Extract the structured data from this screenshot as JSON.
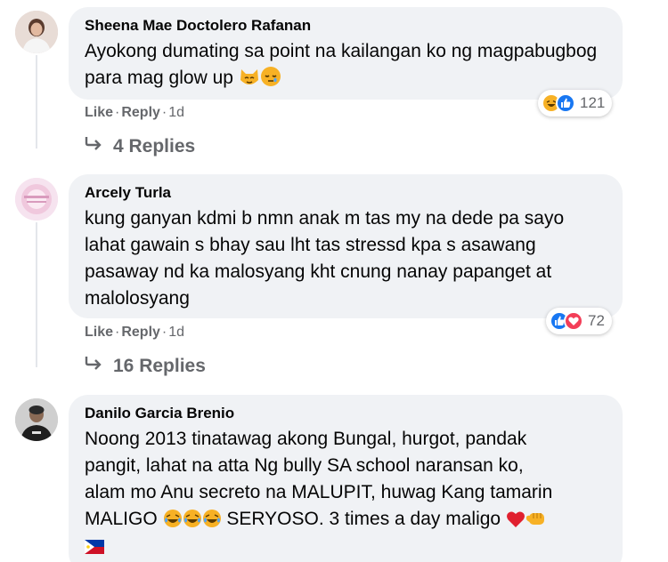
{
  "comments": [
    {
      "author": "Sheena Mae Doctolero Rafanan",
      "text": "Ayokong dumating sa point na kailangan ko ng magpabugbog para mag glow up",
      "like": "Like",
      "reply": "Reply",
      "time": "1d",
      "reaction_icons": [
        "haha-icon",
        "like-icon"
      ],
      "reaction_count": "121",
      "replies_label": "4 Replies"
    },
    {
      "author": "Arcely Turla",
      "text": "kung ganyan kdmi b nmn anak m tas my na dede pa sayo lahat gawain s bhay sau lht tas stressd kpa s asawang pasaway nd ka malosyang kht cnung nanay papanget at malolosyang",
      "like": "Like",
      "reply": "Reply",
      "time": "1d",
      "reaction_icons": [
        "like-icon",
        "love-icon"
      ],
      "reaction_count": "72",
      "replies_label": "16 Replies"
    },
    {
      "author": "Danilo Garcia Brenio",
      "text_lines": [
        "Noong 2013 tinatawag akong Bungal, hurgot, pandak",
        "pangit, lahat na atta Ng bully SA school naransan ko,",
        "alam mo Anu secreto na MALUPIT, huwag Kang tamarin",
        "MALIGO",
        "SERYOSO. 3 times a day maligo"
      ]
    }
  ],
  "colors": {
    "bubble": "#f0f2f5",
    "meta": "#65676b",
    "like_blue": "#1877f2",
    "love_red": "#f33e58",
    "haha_yellow": "#f7b125"
  }
}
